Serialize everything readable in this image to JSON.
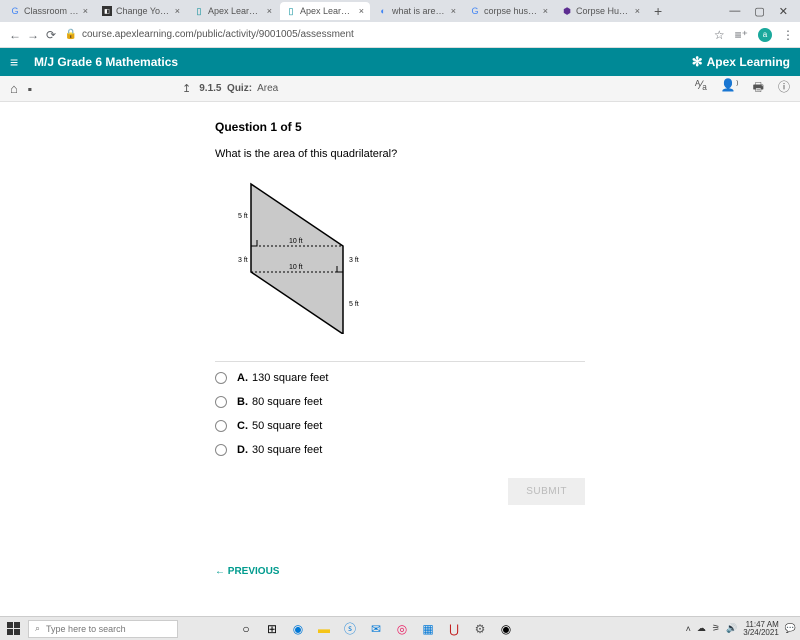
{
  "browser": {
    "tabs": [
      {
        "label": "Classroom | Goo"
      },
      {
        "label": "Change Your Pa"
      },
      {
        "label": "Apex Learning"
      },
      {
        "label": "Apex Learning"
      },
      {
        "label": "what is area of"
      },
      {
        "label": "corpse husband"
      },
      {
        "label": "Corpse Husban"
      }
    ],
    "url": "course.apexlearning.com/public/activity/9001005/assessment",
    "avatar_letter": "a"
  },
  "apex": {
    "course_title": "M/J Grade 6 Mathematics",
    "brand": "Apex Learning"
  },
  "breadcrumb": {
    "code": "9.1.5",
    "type": "Quiz:",
    "topic": "Area"
  },
  "question": {
    "title": "Question 1 of 5",
    "prompt": "What is the area of this quadrilateral?",
    "options": [
      {
        "letter": "A.",
        "text": "130 square feet"
      },
      {
        "letter": "B.",
        "text": "80 square feet"
      },
      {
        "letter": "C.",
        "text": "50 square feet"
      },
      {
        "letter": "D.",
        "text": "30 square feet"
      }
    ],
    "submit": "SUBMIT",
    "previous": "PREVIOUS"
  },
  "figure_labels": {
    "top_left": "5 ft",
    "mid_left": "3 ft",
    "mid_top": "10 ft",
    "mid_bottom": "10 ft",
    "mid_right": "3 ft",
    "bottom_right": "5 ft"
  },
  "taskbar": {
    "search_placeholder": "Type here to search",
    "time": "11:47 AM",
    "date": "3/24/2021"
  }
}
